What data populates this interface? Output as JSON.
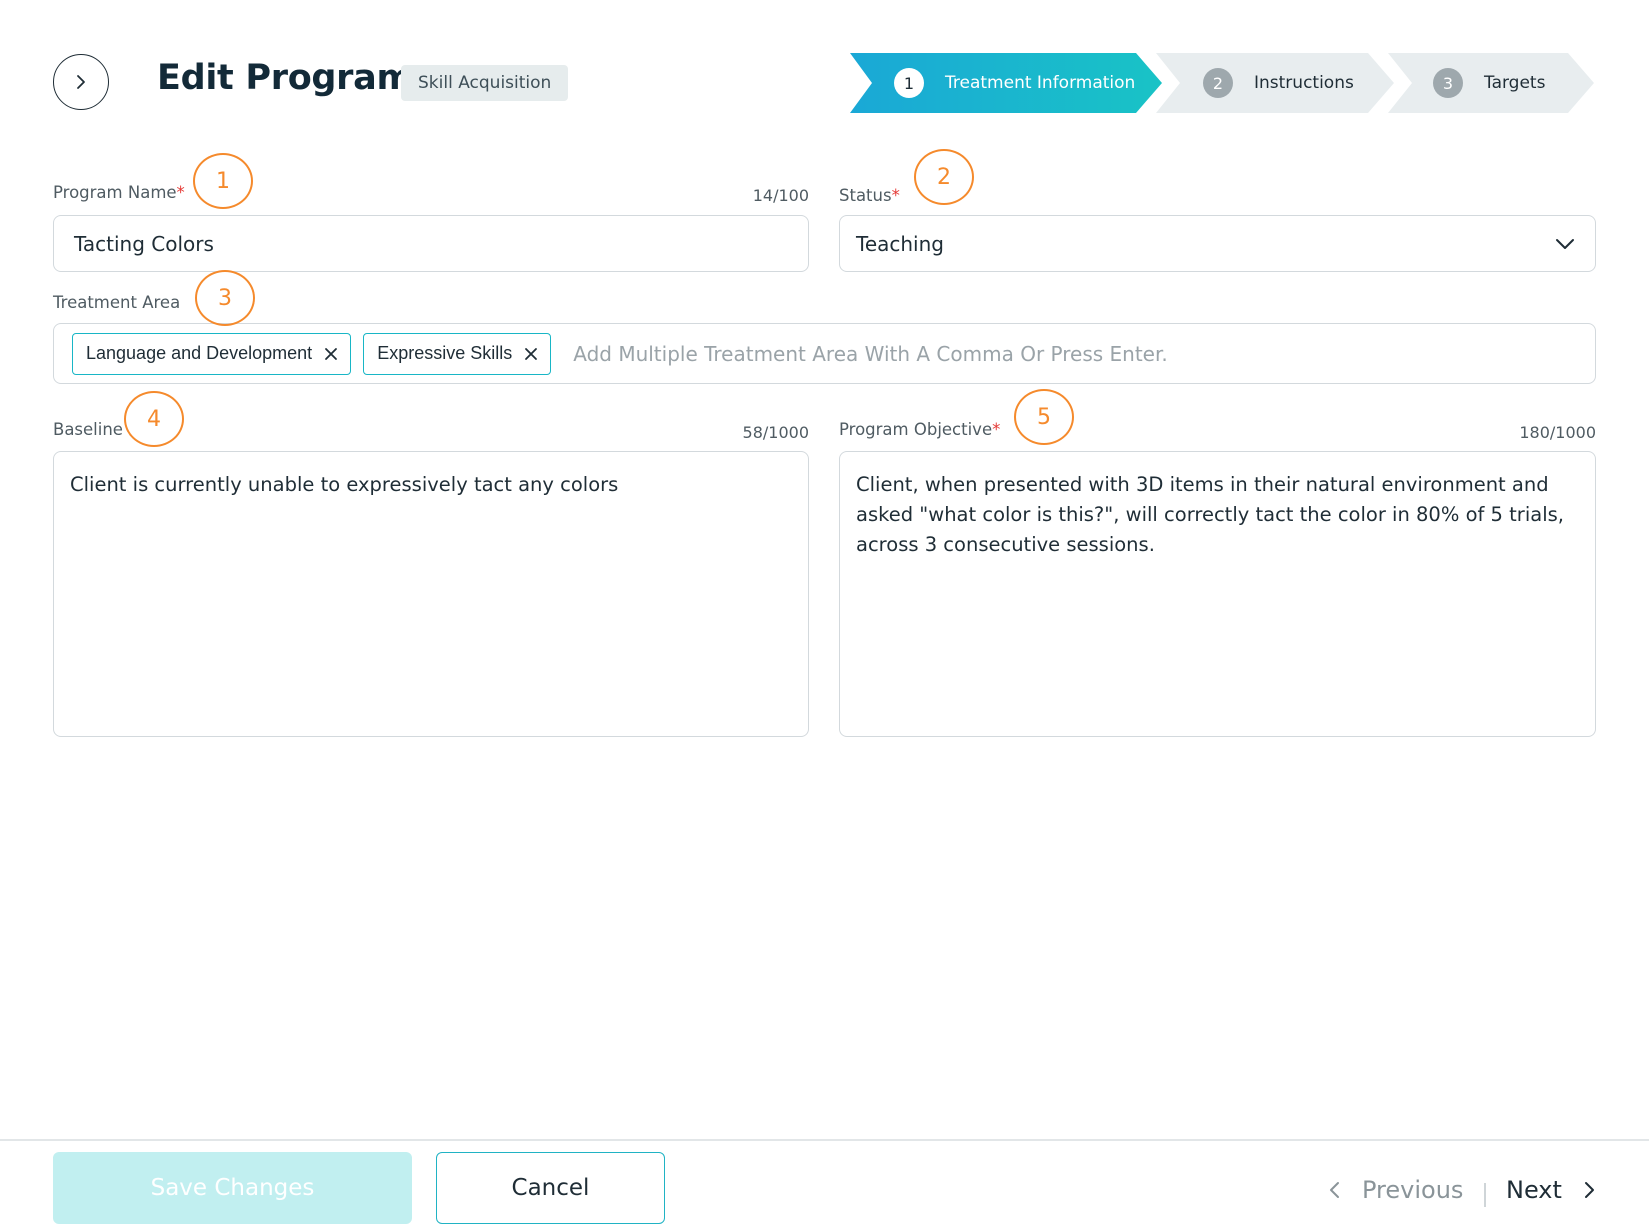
{
  "header": {
    "title": "Edit Program",
    "badge": "Skill Acquisition"
  },
  "stepper": {
    "steps": [
      {
        "number": "1",
        "label": "Treatment Information",
        "state": "active"
      },
      {
        "number": "2",
        "label": "Instructions",
        "state": "inactive"
      },
      {
        "number": "3",
        "label": "Targets",
        "state": "inactive"
      }
    ],
    "colors": {
      "active_start": "#1aa8d6",
      "active_end": "#19c3c6",
      "inactive": "#e8edef"
    }
  },
  "form": {
    "program_name": {
      "label": "Program Name",
      "required_mark": "*",
      "counter": "14/100",
      "value": "Tacting Colors"
    },
    "status": {
      "label": "Status",
      "required_mark": "*",
      "value": "Teaching"
    },
    "treatment_area": {
      "label": "Treatment Area",
      "tags": [
        "Language and Development",
        "Expressive Skills"
      ],
      "placeholder": "Add Multiple Treatment Area With A Comma Or Press Enter."
    },
    "baseline": {
      "label": "Baseline",
      "counter": "58/1000",
      "value": "Client is currently unable to expressively tact any colors"
    },
    "program_objective": {
      "label": "Program Objective",
      "required_mark": "*",
      "counter": "180/1000",
      "value": "Client, when presented with 3D items in their natural environment and asked \"what color is this?\", will correctly tact the color in 80% of 5 trials, across 3 consecutive sessions."
    }
  },
  "annotations": [
    "1",
    "2",
    "3",
    "4",
    "5"
  ],
  "footer": {
    "save_label": "Save Changes",
    "cancel_label": "Cancel",
    "previous_label": "Previous",
    "next_label": "Next"
  },
  "icons": {
    "back": "chevron-right-icon",
    "status_dropdown": "chevron-down-icon",
    "tag_remove": "close-icon",
    "previous": "chevron-left-icon",
    "next": "chevron-right-icon"
  },
  "colors": {
    "accent": "#19b4c4",
    "required": "#e53935",
    "annotation": "#f58a2c",
    "save_disabled": "#c1eff0"
  }
}
